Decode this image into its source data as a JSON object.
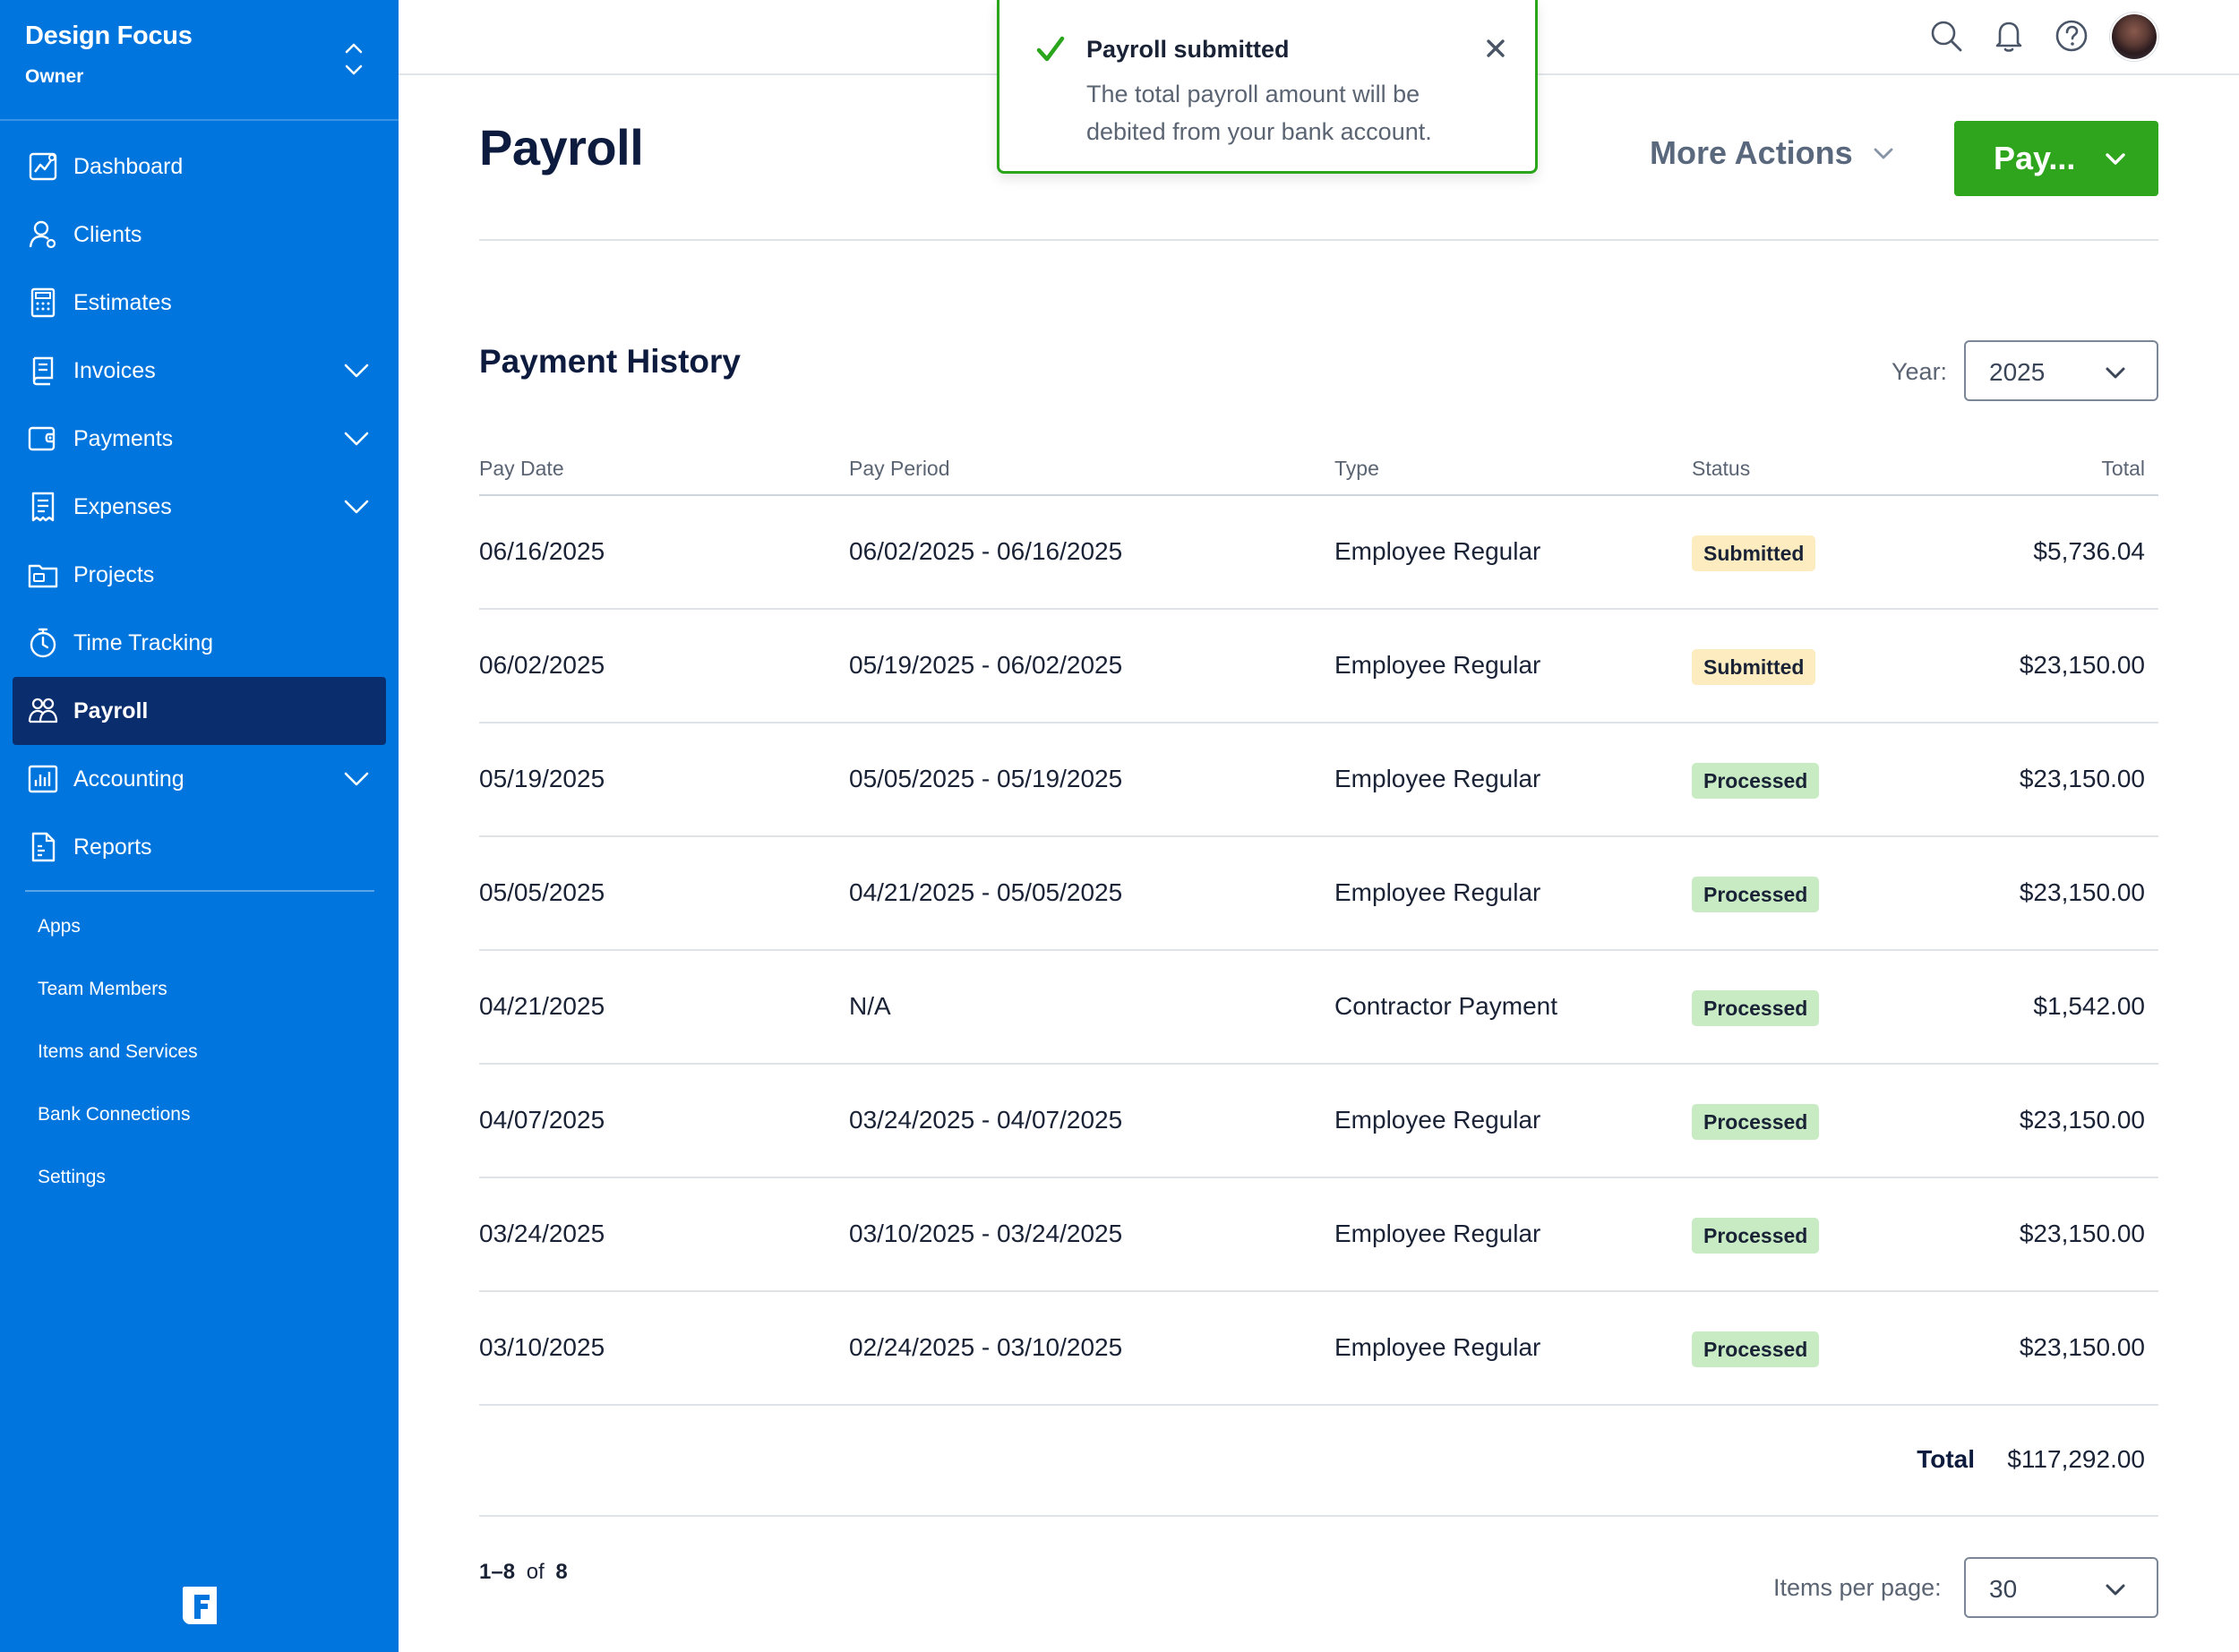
{
  "sidebar": {
    "business_name": "Design Focus",
    "role": "Owner",
    "items": [
      {
        "label": "Dashboard",
        "icon": "dashboard-icon"
      },
      {
        "label": "Clients",
        "icon": "clients-icon"
      },
      {
        "label": "Estimates",
        "icon": "estimates-icon"
      },
      {
        "label": "Invoices",
        "icon": "invoices-icon",
        "expandable": true
      },
      {
        "label": "Payments",
        "icon": "payments-icon",
        "expandable": true
      },
      {
        "label": "Expenses",
        "icon": "expenses-icon",
        "expandable": true
      },
      {
        "label": "Projects",
        "icon": "projects-icon"
      },
      {
        "label": "Time Tracking",
        "icon": "stopwatch-icon"
      },
      {
        "label": "Payroll",
        "icon": "people-icon",
        "active": true
      },
      {
        "label": "Accounting",
        "icon": "accounting-icon",
        "expandable": true
      },
      {
        "label": "Reports",
        "icon": "reports-icon"
      }
    ],
    "secondary": [
      "Apps",
      "Team Members",
      "Items and Services",
      "Bank Connections",
      "Settings"
    ]
  },
  "toast": {
    "title": "Payroll submitted",
    "body": "The total payroll amount will be debited from your bank account."
  },
  "header": {
    "title": "Payroll",
    "more_actions": "More Actions",
    "pay_button": "Pay..."
  },
  "history": {
    "title": "Payment History",
    "year_label": "Year:",
    "year_value": "2025",
    "columns": [
      "Pay Date",
      "Pay Period",
      "Type",
      "Status",
      "Total"
    ],
    "rows": [
      {
        "pay_date": "06/16/2025",
        "pay_period": "06/02/2025 - 06/16/2025",
        "type": "Employee Regular",
        "status": "Submitted",
        "total": "$5,736.04"
      },
      {
        "pay_date": "06/02/2025",
        "pay_period": "05/19/2025 - 06/02/2025",
        "type": "Employee Regular",
        "status": "Submitted",
        "total": "$23,150.00"
      },
      {
        "pay_date": "05/19/2025",
        "pay_period": "05/05/2025 - 05/19/2025",
        "type": "Employee Regular",
        "status": "Processed",
        "total": "$23,150.00"
      },
      {
        "pay_date": "05/05/2025",
        "pay_period": "04/21/2025 - 05/05/2025",
        "type": "Employee Regular",
        "status": "Processed",
        "total": "$23,150.00"
      },
      {
        "pay_date": "04/21/2025",
        "pay_period": "N/A",
        "type": "Contractor Payment",
        "status": "Processed",
        "total": "$1,542.00"
      },
      {
        "pay_date": "04/07/2025",
        "pay_period": "03/24/2025 - 04/07/2025",
        "type": "Employee Regular",
        "status": "Processed",
        "total": "$23,150.00"
      },
      {
        "pay_date": "03/24/2025",
        "pay_period": "03/10/2025 - 03/24/2025",
        "type": "Employee Regular",
        "status": "Processed",
        "total": "$23,150.00"
      },
      {
        "pay_date": "03/10/2025",
        "pay_period": "02/24/2025 - 03/10/2025",
        "type": "Employee Regular",
        "status": "Processed",
        "total": "$23,150.00"
      }
    ],
    "total_label": "Total",
    "total_value": "$117,292.00"
  },
  "pagination": {
    "range": "1–8",
    "of_label": "of",
    "count": "8",
    "items_per_page_label": "Items per page:",
    "items_per_page_value": "30"
  },
  "colors": {
    "sidebar_bg": "#0075dd",
    "active_nav_bg": "#0a2d6e",
    "pay_button": "#2ea51c",
    "badge_submitted": "#fcecc0",
    "badge_processed": "#c8ebc4"
  }
}
